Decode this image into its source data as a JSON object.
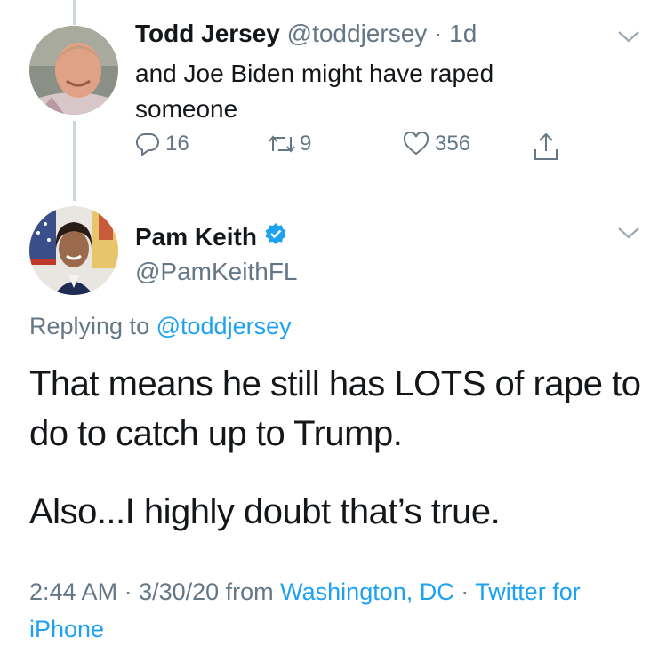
{
  "parent_tweet": {
    "display_name": "Todd Jersey",
    "handle": "@toddjersey",
    "separator": "·",
    "time": "1d",
    "text": "and Joe Biden might have raped someone",
    "actions": {
      "reply_count": "16",
      "retweet_count": "9",
      "like_count": "356"
    }
  },
  "reply_tweet": {
    "display_name": "Pam Keith",
    "verified": true,
    "handle": "@PamKeithFL",
    "replying_prefix": "Replying to",
    "replying_handle": "@toddjersey",
    "paragraphs": [
      "That means he still has LOTS of rape to do to catch up to Trump.",
      "Also...I highly doubt that’s true."
    ],
    "meta": {
      "time": "2:44 AM",
      "sep1": " · ",
      "date": "3/30/20",
      "from_word": " from ",
      "location": "Washington, DC",
      "sep2": " · ",
      "source": "Twitter for iPhone"
    }
  },
  "colors": {
    "link": "#1da1f2",
    "secondary_text": "#657786",
    "primary_text": "#14171a",
    "thread_line": "#cdd6dd"
  },
  "icons": [
    "reply-icon",
    "retweet-icon",
    "like-icon",
    "share-icon",
    "chevron-down-icon",
    "verified-badge-icon"
  ]
}
